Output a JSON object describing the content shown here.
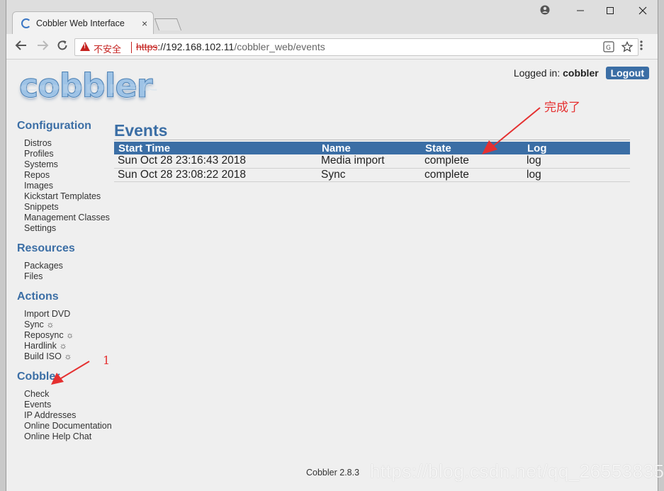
{
  "browser": {
    "tab_title": "Cobbler Web Interface",
    "tab_close": "×",
    "address": {
      "security_label": "不安全",
      "scheme": "https",
      "host": "://192.168.102.11",
      "path": "/cobbler_web/events"
    }
  },
  "header": {
    "logo_text": "cobbler",
    "logged_in_label": "Logged in:",
    "username": "cobbler",
    "logout_label": "Logout"
  },
  "sidebar": {
    "sections": [
      {
        "title": "Configuration",
        "items": [
          "Distros",
          "Profiles",
          "Systems",
          "Repos",
          "Images",
          "Kickstart Templates",
          "Snippets",
          "Management Classes",
          "Settings"
        ]
      },
      {
        "title": "Resources",
        "items": [
          "Packages",
          "Files"
        ]
      },
      {
        "title": "Actions",
        "items": [
          "Import DVD",
          "Sync ☼",
          "Reposync ☼",
          "Hardlink ☼",
          "Build ISO ☼"
        ]
      },
      {
        "title": "Cobbler",
        "items": [
          "Check",
          "Events",
          "IP Addresses",
          "Online Documentation",
          "Online Help Chat"
        ]
      }
    ]
  },
  "main": {
    "title": "Events",
    "columns": [
      "Start Time",
      "Name",
      "State",
      "Log"
    ],
    "rows": [
      [
        "Sun Oct 28 23:16:43 2018",
        "Media import",
        "complete",
        "log"
      ],
      [
        "Sun Oct 28 23:08:22 2018",
        "Sync",
        "complete",
        "log"
      ]
    ]
  },
  "footer": {
    "version": "Cobbler 2.8.3"
  },
  "annotations": {
    "done_label": "完成了",
    "step_label": "1"
  },
  "watermark": "https://blog.csdn.net/qq_26553835",
  "colors": {
    "accent": "#3b6ea5",
    "annotation": "#e53030",
    "insecure": "#c5221f"
  }
}
